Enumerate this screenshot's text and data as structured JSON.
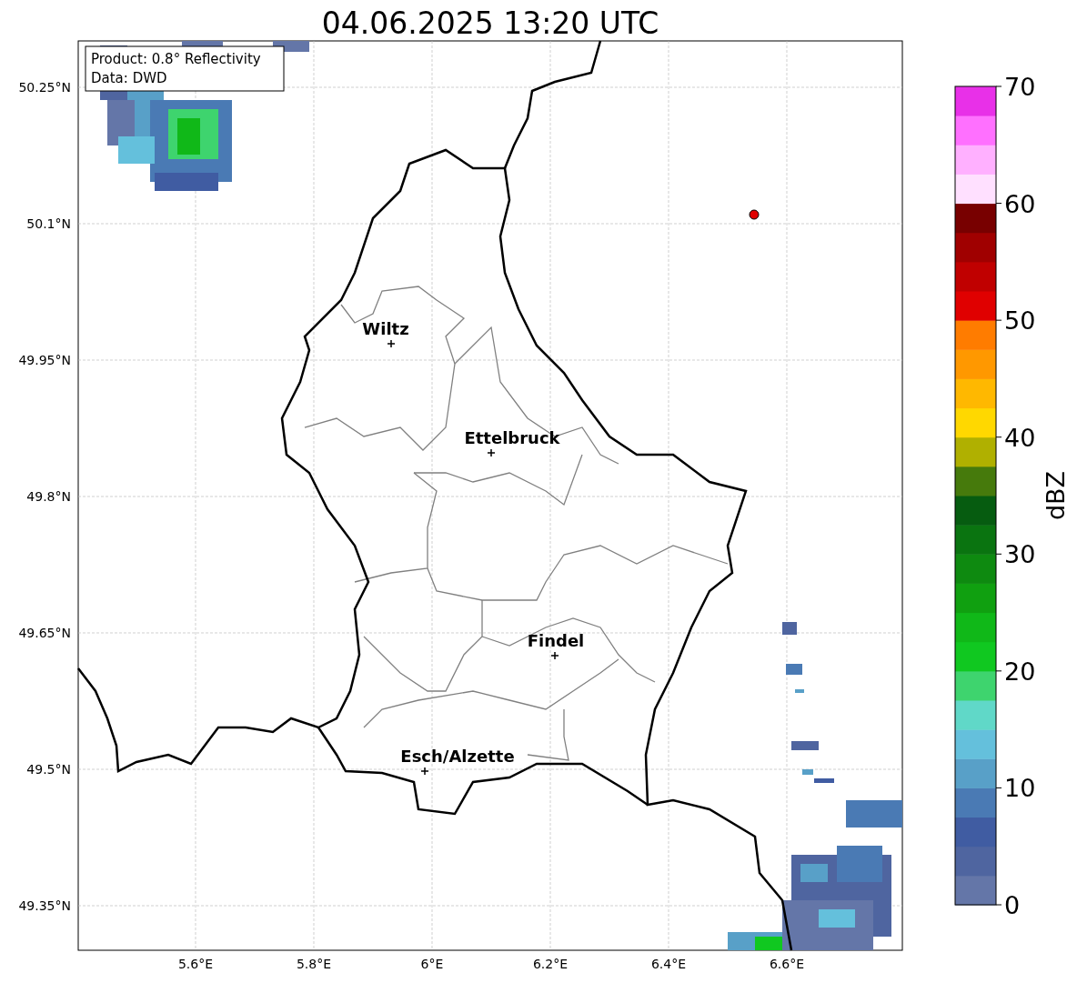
{
  "title": "04.06.2025 13:20 UTC",
  "info_box": [
    "Product: 0.8° Reflectivity",
    "Data: DWD"
  ],
  "cities": [
    {
      "name": "Wiltz"
    },
    {
      "name": "Ettelbruck"
    },
    {
      "name": "Findel"
    },
    {
      "name": "Esch/Alzette"
    }
  ],
  "x_ticks": [
    "5.6°E",
    "5.8°E",
    "6°E",
    "6.2°E",
    "6.4°E",
    "6.6°E"
  ],
  "y_ticks": [
    "50.25°N",
    "50.1°N",
    "49.95°N",
    "49.8°N",
    "49.65°N",
    "49.5°N",
    "49.35°N"
  ],
  "colorbar": {
    "label": "dBZ",
    "ticks": [
      "70",
      "60",
      "50",
      "40",
      "30",
      "20",
      "10",
      "0"
    ],
    "bins": [
      {
        "color": "#6476a8"
      },
      {
        "color": "#4f65a0"
      },
      {
        "color": "#405ca2"
      },
      {
        "color": "#4a7ab4"
      },
      {
        "color": "#58a0c8"
      },
      {
        "color": "#64c0dc"
      },
      {
        "color": "#60d8c8"
      },
      {
        "color": "#3ed46e"
      },
      {
        "color": "#10c820"
      },
      {
        "color": "#10b818"
      },
      {
        "color": "#10a010"
      },
      {
        "color": "#0e8a10"
      },
      {
        "color": "#0a7410"
      },
      {
        "color": "#065c10"
      },
      {
        "color": "#467a0c"
      },
      {
        "color": "#b0b000"
      },
      {
        "color": "#ffd800"
      },
      {
        "color": "#ffb800"
      },
      {
        "color": "#ff9800"
      },
      {
        "color": "#ff7c00"
      },
      {
        "color": "#e00000"
      },
      {
        "color": "#c00000"
      },
      {
        "color": "#a00000"
      },
      {
        "color": "#780000"
      },
      {
        "color": "#ffe0ff"
      },
      {
        "color": "#ffb0ff"
      },
      {
        "color": "#ff70ff"
      },
      {
        "color": "#e830e8"
      }
    ]
  }
}
